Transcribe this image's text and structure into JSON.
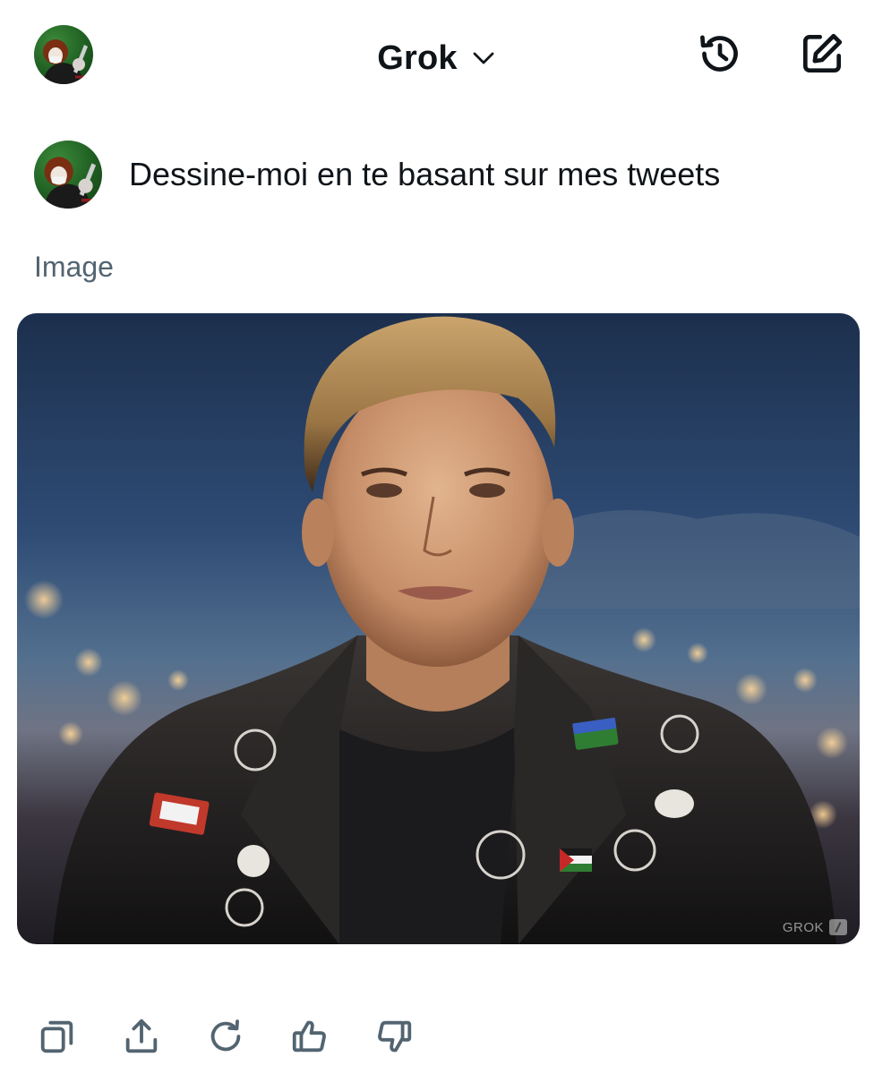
{
  "header": {
    "title": "Grok",
    "icons": {
      "avatar": "user-avatar",
      "dropdown": "chevron-down-icon",
      "history": "history-icon",
      "new_chat": "compose-icon"
    }
  },
  "conversation": {
    "prompt": "Dessine-moi en te basant sur mes tweets",
    "response_label": "Image",
    "image_watermark": "GROK"
  },
  "actions": [
    {
      "name": "copy",
      "icon": "copy-icon"
    },
    {
      "name": "share",
      "icon": "share-icon"
    },
    {
      "name": "regenerate",
      "icon": "refresh-icon"
    },
    {
      "name": "like",
      "icon": "thumbs-up-icon"
    },
    {
      "name": "dislike",
      "icon": "thumbs-down-icon"
    }
  ],
  "colors": {
    "text": "#0f1419",
    "secondary_text": "#536471",
    "background": "#ffffff",
    "avatar_green": "#2e7a30"
  }
}
